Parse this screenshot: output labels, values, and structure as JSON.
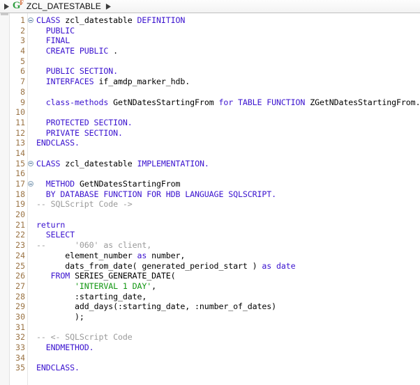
{
  "breadcrumb": {
    "leading_arrow": "▶",
    "trailing_arrow": "▶",
    "icon_letter": "G",
    "icon_superscript": "F",
    "icon_name": "abap-global-class-icon",
    "title": "ZCL_DATESTABLE",
    "colors": {
      "icon_green": "#2f9e41",
      "icon_orange": "#c8541a",
      "bar_background": "#f3f3f3"
    }
  },
  "editor": {
    "language": "ABAP",
    "colors": {
      "keyword": "#3a12cf",
      "identifier": "#000000",
      "comment": "#9a9a9a",
      "string": "#119611",
      "line_number": "#9a7344",
      "background": "#ffffff"
    },
    "fold_marker_lines": [
      1,
      15,
      17
    ],
    "lines": [
      {
        "n": "1",
        "fold": true,
        "tokens": [
          {
            "t": "kw",
            "s": "CLASS"
          },
          {
            "t": "plain",
            "s": " "
          },
          {
            "t": "id",
            "s": "zcl_datestable"
          },
          {
            "t": "plain",
            "s": " "
          },
          {
            "t": "kw",
            "s": "DEFINITION"
          }
        ]
      },
      {
        "n": "2",
        "fold": false,
        "tokens": [
          {
            "t": "kw",
            "s": "  PUBLIC"
          }
        ]
      },
      {
        "n": "3",
        "fold": false,
        "tokens": [
          {
            "t": "kw",
            "s": "  FINAL"
          }
        ]
      },
      {
        "n": "4",
        "fold": false,
        "tokens": [
          {
            "t": "kw",
            "s": "  CREATE PUBLIC"
          },
          {
            "t": "plain",
            "s": " ."
          }
        ]
      },
      {
        "n": "5",
        "fold": false,
        "tokens": [
          {
            "t": "plain",
            "s": ""
          }
        ]
      },
      {
        "n": "6",
        "fold": false,
        "tokens": [
          {
            "t": "kw",
            "s": "  PUBLIC SECTION."
          }
        ]
      },
      {
        "n": "7",
        "fold": false,
        "tokens": [
          {
            "t": "kw",
            "s": "  INTERFACES"
          },
          {
            "t": "plain",
            "s": " "
          },
          {
            "t": "id",
            "s": "if_amdp_marker_hdb."
          }
        ]
      },
      {
        "n": "8",
        "fold": false,
        "tokens": [
          {
            "t": "plain",
            "s": ""
          }
        ]
      },
      {
        "n": "9",
        "fold": false,
        "tokens": [
          {
            "t": "kw",
            "s": "  class-methods"
          },
          {
            "t": "plain",
            "s": " "
          },
          {
            "t": "id",
            "s": "GetNDatesStartingFrom"
          },
          {
            "t": "plain",
            "s": " "
          },
          {
            "t": "kw",
            "s": "for TABLE FUNCTION"
          },
          {
            "t": "plain",
            "s": " "
          },
          {
            "t": "id",
            "s": "ZGetNDatesStartingFrom."
          }
        ]
      },
      {
        "n": "10",
        "fold": false,
        "tokens": [
          {
            "t": "plain",
            "s": ""
          }
        ]
      },
      {
        "n": "11",
        "fold": false,
        "tokens": [
          {
            "t": "kw",
            "s": "  PROTECTED SECTION."
          }
        ]
      },
      {
        "n": "12",
        "fold": false,
        "tokens": [
          {
            "t": "kw",
            "s": "  PRIVATE SECTION."
          }
        ]
      },
      {
        "n": "13",
        "fold": false,
        "tokens": [
          {
            "t": "kw",
            "s": "ENDCLASS."
          }
        ]
      },
      {
        "n": "14",
        "fold": false,
        "tokens": [
          {
            "t": "plain",
            "s": ""
          }
        ]
      },
      {
        "n": "15",
        "fold": true,
        "tokens": [
          {
            "t": "kw",
            "s": "CLASS"
          },
          {
            "t": "plain",
            "s": " "
          },
          {
            "t": "id",
            "s": "zcl_datestable"
          },
          {
            "t": "plain",
            "s": " "
          },
          {
            "t": "kw",
            "s": "IMPLEMENTATION."
          }
        ]
      },
      {
        "n": "16",
        "fold": false,
        "tokens": [
          {
            "t": "plain",
            "s": ""
          }
        ]
      },
      {
        "n": "17",
        "fold": true,
        "tokens": [
          {
            "t": "kw",
            "s": "  METHOD"
          },
          {
            "t": "plain",
            "s": " "
          },
          {
            "t": "id",
            "s": "GetNDatesStartingFrom"
          }
        ]
      },
      {
        "n": "18",
        "fold": false,
        "tokens": [
          {
            "t": "kw",
            "s": "  BY DATABASE FUNCTION FOR HDB LANGUAGE SQLSCRIPT."
          }
        ]
      },
      {
        "n": "19",
        "fold": false,
        "tokens": [
          {
            "t": "cmt",
            "s": "-- SQLScript Code ->"
          }
        ]
      },
      {
        "n": "20",
        "fold": false,
        "tokens": [
          {
            "t": "plain",
            "s": ""
          }
        ]
      },
      {
        "n": "21",
        "fold": false,
        "tokens": [
          {
            "t": "kw",
            "s": "return"
          }
        ]
      },
      {
        "n": "22",
        "fold": false,
        "tokens": [
          {
            "t": "kw",
            "s": "  SELECT"
          }
        ]
      },
      {
        "n": "23",
        "fold": false,
        "tokens": [
          {
            "t": "cmt",
            "s": "--      '060' as client,"
          }
        ]
      },
      {
        "n": "24",
        "fold": false,
        "tokens": [
          {
            "t": "plain",
            "s": "      "
          },
          {
            "t": "id",
            "s": "element_number"
          },
          {
            "t": "plain",
            "s": " "
          },
          {
            "t": "kw",
            "s": "as"
          },
          {
            "t": "plain",
            "s": " "
          },
          {
            "t": "id",
            "s": "number,"
          }
        ]
      },
      {
        "n": "25",
        "fold": false,
        "tokens": [
          {
            "t": "plain",
            "s": "      "
          },
          {
            "t": "id",
            "s": "dats_from_date( generated_period_start )"
          },
          {
            "t": "plain",
            "s": " "
          },
          {
            "t": "kw",
            "s": "as date"
          }
        ]
      },
      {
        "n": "26",
        "fold": false,
        "tokens": [
          {
            "t": "kw",
            "s": "   FROM"
          },
          {
            "t": "plain",
            "s": " "
          },
          {
            "t": "id",
            "s": "SERIES_GENERATE_DATE("
          }
        ]
      },
      {
        "n": "27",
        "fold": false,
        "tokens": [
          {
            "t": "plain",
            "s": "        "
          },
          {
            "t": "str",
            "s": "'INTERVAL 1 DAY'"
          },
          {
            "t": "plain",
            "s": ","
          }
        ]
      },
      {
        "n": "28",
        "fold": false,
        "tokens": [
          {
            "t": "plain",
            "s": "        "
          },
          {
            "t": "id",
            "s": ":starting_date,"
          }
        ]
      },
      {
        "n": "29",
        "fold": false,
        "tokens": [
          {
            "t": "plain",
            "s": "        "
          },
          {
            "t": "id",
            "s": "add_days(:starting_date, :number_of_dates)"
          }
        ]
      },
      {
        "n": "30",
        "fold": false,
        "tokens": [
          {
            "t": "plain",
            "s": "        );"
          }
        ]
      },
      {
        "n": "31",
        "fold": false,
        "tokens": [
          {
            "t": "plain",
            "s": ""
          }
        ]
      },
      {
        "n": "32",
        "fold": false,
        "tokens": [
          {
            "t": "cmt",
            "s": "-- <- SQLScript Code"
          }
        ]
      },
      {
        "n": "33",
        "fold": false,
        "tokens": [
          {
            "t": "kw",
            "s": "  ENDMETHOD."
          }
        ]
      },
      {
        "n": "34",
        "fold": false,
        "tokens": [
          {
            "t": "plain",
            "s": ""
          }
        ]
      },
      {
        "n": "35",
        "fold": false,
        "tokens": [
          {
            "t": "kw",
            "s": "ENDCLASS."
          }
        ]
      }
    ]
  }
}
